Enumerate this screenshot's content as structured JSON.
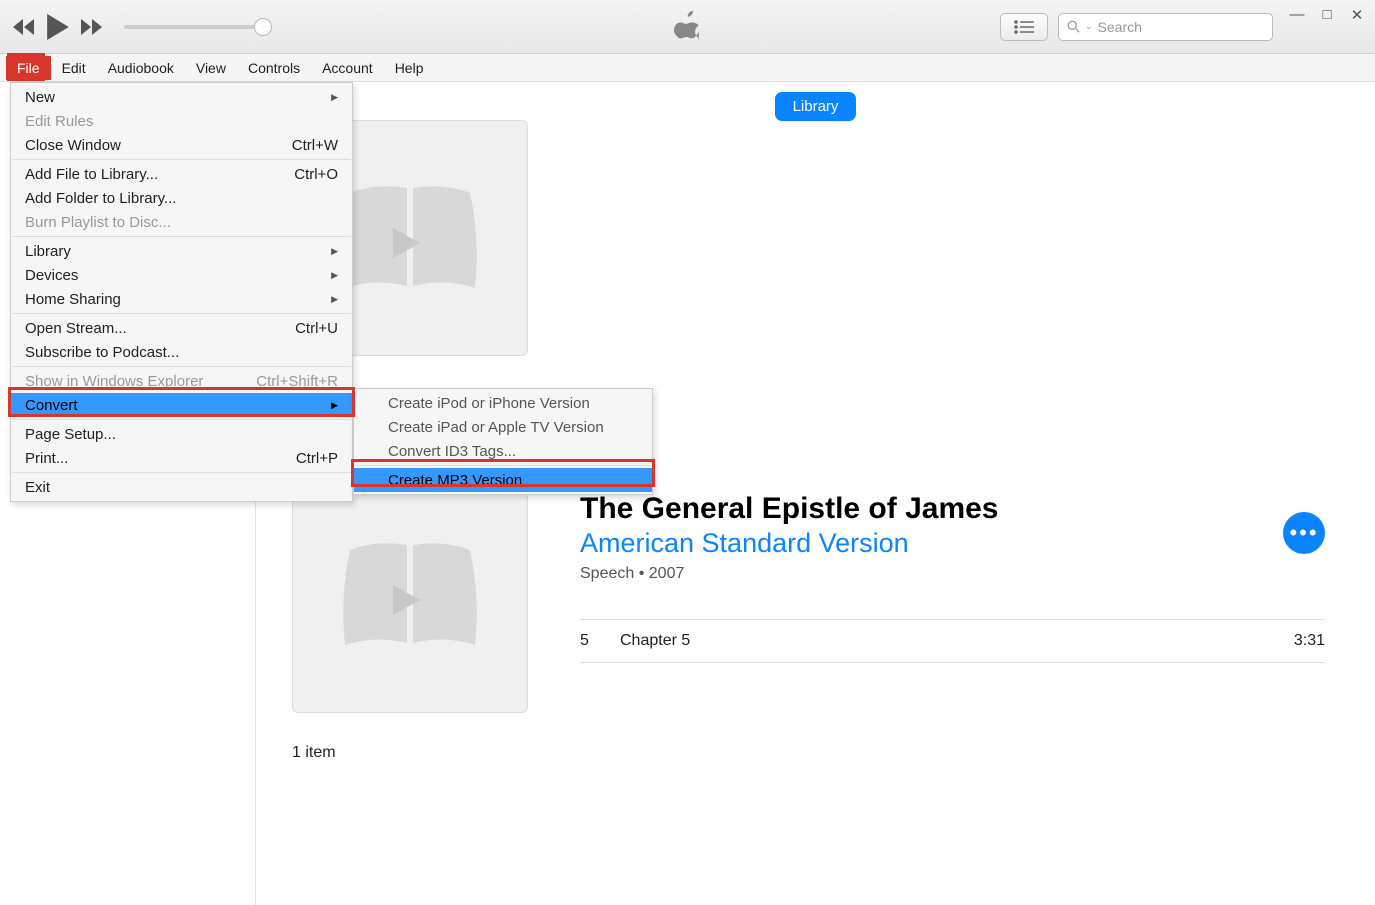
{
  "menubar": [
    "File",
    "Edit",
    "Audiobook",
    "View",
    "Controls",
    "Account",
    "Help"
  ],
  "active_menu": "File",
  "search_placeholder": "Search",
  "tab_label": "Library",
  "file_menu": [
    {
      "label": "New",
      "shortcut": "",
      "submenu": true
    },
    {
      "label": "Edit Rules",
      "disabled": true
    },
    {
      "label": "Close Window",
      "shortcut": "Ctrl+W"
    },
    {
      "sep": true
    },
    {
      "label": "Add File to Library...",
      "shortcut": "Ctrl+O"
    },
    {
      "label": "Add Folder to Library..."
    },
    {
      "label": "Burn Playlist to Disc...",
      "disabled": true
    },
    {
      "sep": true
    },
    {
      "label": "Library",
      "submenu": true
    },
    {
      "label": "Devices",
      "submenu": true
    },
    {
      "label": "Home Sharing",
      "submenu": true
    },
    {
      "sep": true
    },
    {
      "label": "Open Stream...",
      "shortcut": "Ctrl+U"
    },
    {
      "label": "Subscribe to Podcast..."
    },
    {
      "sep": true
    },
    {
      "label": "Show in Windows Explorer",
      "shortcut": "Ctrl+Shift+R",
      "disabled": true
    },
    {
      "label": "Convert",
      "submenu": true,
      "highlighted": true
    },
    {
      "sep": true
    },
    {
      "label": "Page Setup..."
    },
    {
      "label": "Print...",
      "shortcut": "Ctrl+P"
    },
    {
      "sep": true
    },
    {
      "label": "Exit"
    }
  ],
  "convert_menu": [
    {
      "label": "Create iPod or iPhone Version"
    },
    {
      "label": "Create iPad or Apple TV Version"
    },
    {
      "label": "Convert ID3 Tags..."
    },
    {
      "sep": true
    },
    {
      "label": "Create MP3 Version",
      "highlighted": true
    }
  ],
  "detail": {
    "title": "The General Epistle of James",
    "artist": "American Standard Version",
    "genre": "Speech",
    "year": "2007",
    "track_num": "5",
    "track_name": "Chapter 5",
    "track_dur": "3:31",
    "item_count": "1 item"
  }
}
